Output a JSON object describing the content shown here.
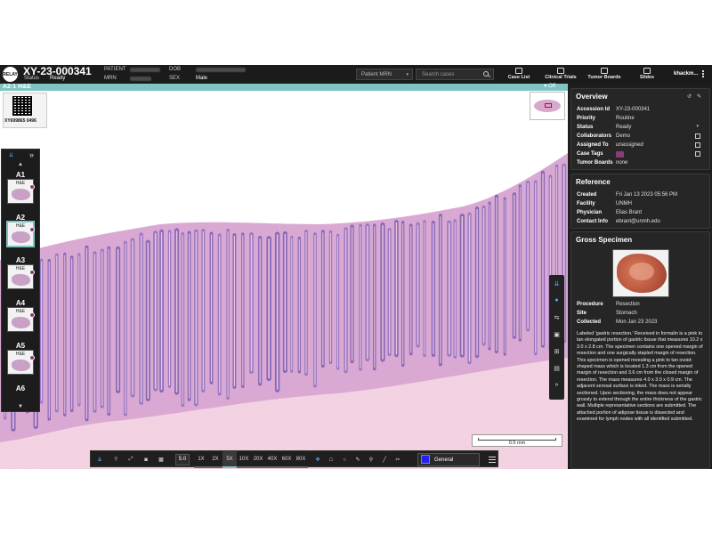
{
  "header": {
    "logo": "RELAY",
    "accession": "XY-23-000341",
    "status_label": "Status",
    "status_value": "Ready",
    "patient_label": "PATIENT",
    "mrn_label": "MRN",
    "dob_label": "DOB",
    "sex_label": "SEX",
    "sex_value": "Male",
    "search_type": "Patient MRN",
    "search_placeholder": "Search cases",
    "nav": [
      {
        "label": "Case List",
        "icon": "list-icon"
      },
      {
        "label": "Clinical Trials",
        "icon": "flask-icon"
      },
      {
        "label": "Tumor Boards",
        "icon": "board-icon"
      },
      {
        "label": "Slides",
        "icon": "slides-icon"
      }
    ],
    "user": "khackm..."
  },
  "slide_bar": {
    "name": "A2-1 H&E",
    "right": "Off"
  },
  "viewer": {
    "label_text": "XY699865 0496",
    "scale_text": "0.5 mm"
  },
  "tray": {
    "items": [
      {
        "id": "A1",
        "stain": "H&E",
        "selected": false
      },
      {
        "id": "A2",
        "stain": "H&E",
        "selected": true
      },
      {
        "id": "A3",
        "stain": "H&E",
        "selected": false
      },
      {
        "id": "A4",
        "stain": "H&E",
        "selected": false
      },
      {
        "id": "A5",
        "stain": "H&E",
        "selected": false
      },
      {
        "id": "A6",
        "stain": "",
        "selected": false
      }
    ]
  },
  "toolbar": {
    "zoom_value": "5.0",
    "zooms": [
      "1X",
      "2X",
      "5X",
      "10X",
      "20X",
      "40X",
      "60X",
      "80X"
    ],
    "active_zoom": "5X",
    "annotation_color": "#2222ee",
    "layer": "General"
  },
  "overview": {
    "title": "Overview",
    "rows": [
      {
        "k": "Accession Id",
        "v": "XY-23-000341"
      },
      {
        "k": "Priority",
        "v": "Routine"
      },
      {
        "k": "Status",
        "v": "Ready"
      },
      {
        "k": "Collaborators",
        "v": "Demo"
      },
      {
        "k": "Assigned To",
        "v": "unassigned"
      },
      {
        "k": "Case Tags",
        "v": ""
      },
      {
        "k": "Tumor Boards",
        "v": "none"
      }
    ]
  },
  "reference": {
    "title": "Reference",
    "rows": [
      {
        "k": "Created",
        "v": "Fri Jan 13 2023 05:56 PM"
      },
      {
        "k": "Facility",
        "v": "UNMH"
      },
      {
        "k": "Physician",
        "v": "Elias Brant"
      },
      {
        "k": "Contact Info",
        "v": "ebrant@unmh.edu"
      }
    ]
  },
  "gross": {
    "title": "Gross Specimen",
    "rows": [
      {
        "k": "Procedure",
        "v": "Resection"
      },
      {
        "k": "Site",
        "v": "Stomach"
      },
      {
        "k": "Collected",
        "v": "Mon Jan 23 2023"
      }
    ],
    "description": "Labeled 'gastric resection.' Received in formalin is a pink to tan elongated portion of gastric tissue that measures 10.2 x 3.0 x 2.8 cm. The specimen contains one opened margin of resection and one surgically stapled margin of resection. This specimen is opened revealing a pink to tan ovoid-shaped mass which is located 1.3 cm from the opened margin of resection and 3.6 cm from the closed margin of resection. The mass measures 4.0 x 3.0 x 0.9 cm. The adjacent serosal surface is inked. The mass is serially sectioned. Upon sectioning, the mass does not appear grossly to extend through the entire thickness of the gastric wall. Multiple representative sections are submitted. The attached portion of adipose tissue is dissected and examined for lymph nodes with all identified submitted."
  },
  "colors": {
    "accent": "#7fc4c4",
    "tag": "#8a3c7a",
    "tissue_dark": "#8a68b8",
    "tissue_light": "#e6b8d6"
  }
}
